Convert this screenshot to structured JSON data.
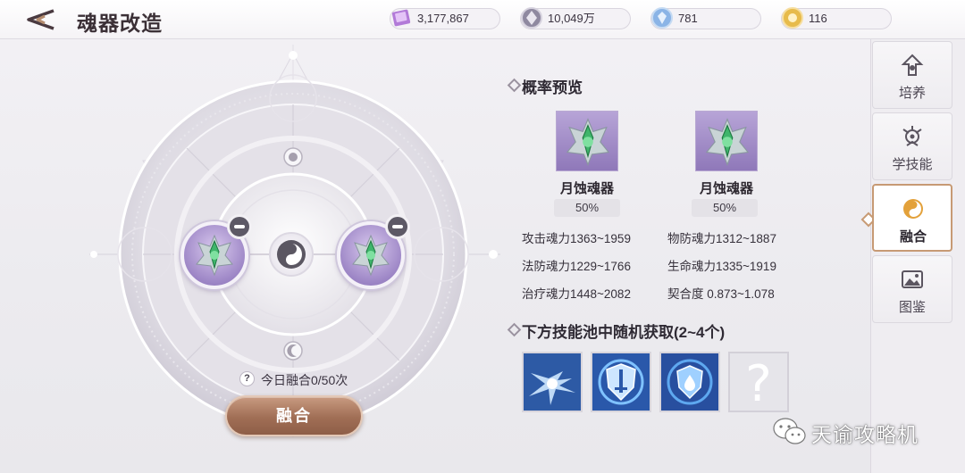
{
  "header": {
    "title": "魂器改造",
    "back_icon": "back-arrow-icon",
    "currencies": [
      {
        "icon": "crystal-card-icon",
        "value": "3,177,867"
      },
      {
        "icon": "silver-coin-icon",
        "value": "10,049万"
      },
      {
        "icon": "blue-gem-icon",
        "value": "781"
      },
      {
        "icon": "gold-token-icon",
        "value": "116"
      }
    ]
  },
  "fusion": {
    "daily_text": "今日融合0/50次",
    "help_symbol": "?",
    "fuse_button": "融合"
  },
  "preview": {
    "title": "概率预览",
    "items": [
      {
        "name": "月蚀魂器",
        "probability": "50%",
        "stats": [
          "攻击魂力1363~1959",
          "法防魂力1229~1766",
          "治疗魂力1448~2082"
        ]
      },
      {
        "name": "月蚀魂器",
        "probability": "50%",
        "stats": [
          "物防魂力1312~1887",
          "生命魂力1335~1919",
          "契合度  0.873~1.078"
        ]
      }
    ],
    "skill_pool_title": "下方技能池中随机获取(2~4个)",
    "unknown_symbol": "?"
  },
  "side_tabs": [
    {
      "label": "培养",
      "icon": "upgrade-arrow-icon",
      "active": false
    },
    {
      "label": "学技能",
      "icon": "skill-emblem-icon",
      "active": false
    },
    {
      "label": "融合",
      "icon": "fusion-swirl-icon",
      "active": true
    },
    {
      "label": "图鉴",
      "icon": "gallery-icon",
      "active": false
    }
  ],
  "watermark": {
    "text": "天谕攻略机"
  }
}
